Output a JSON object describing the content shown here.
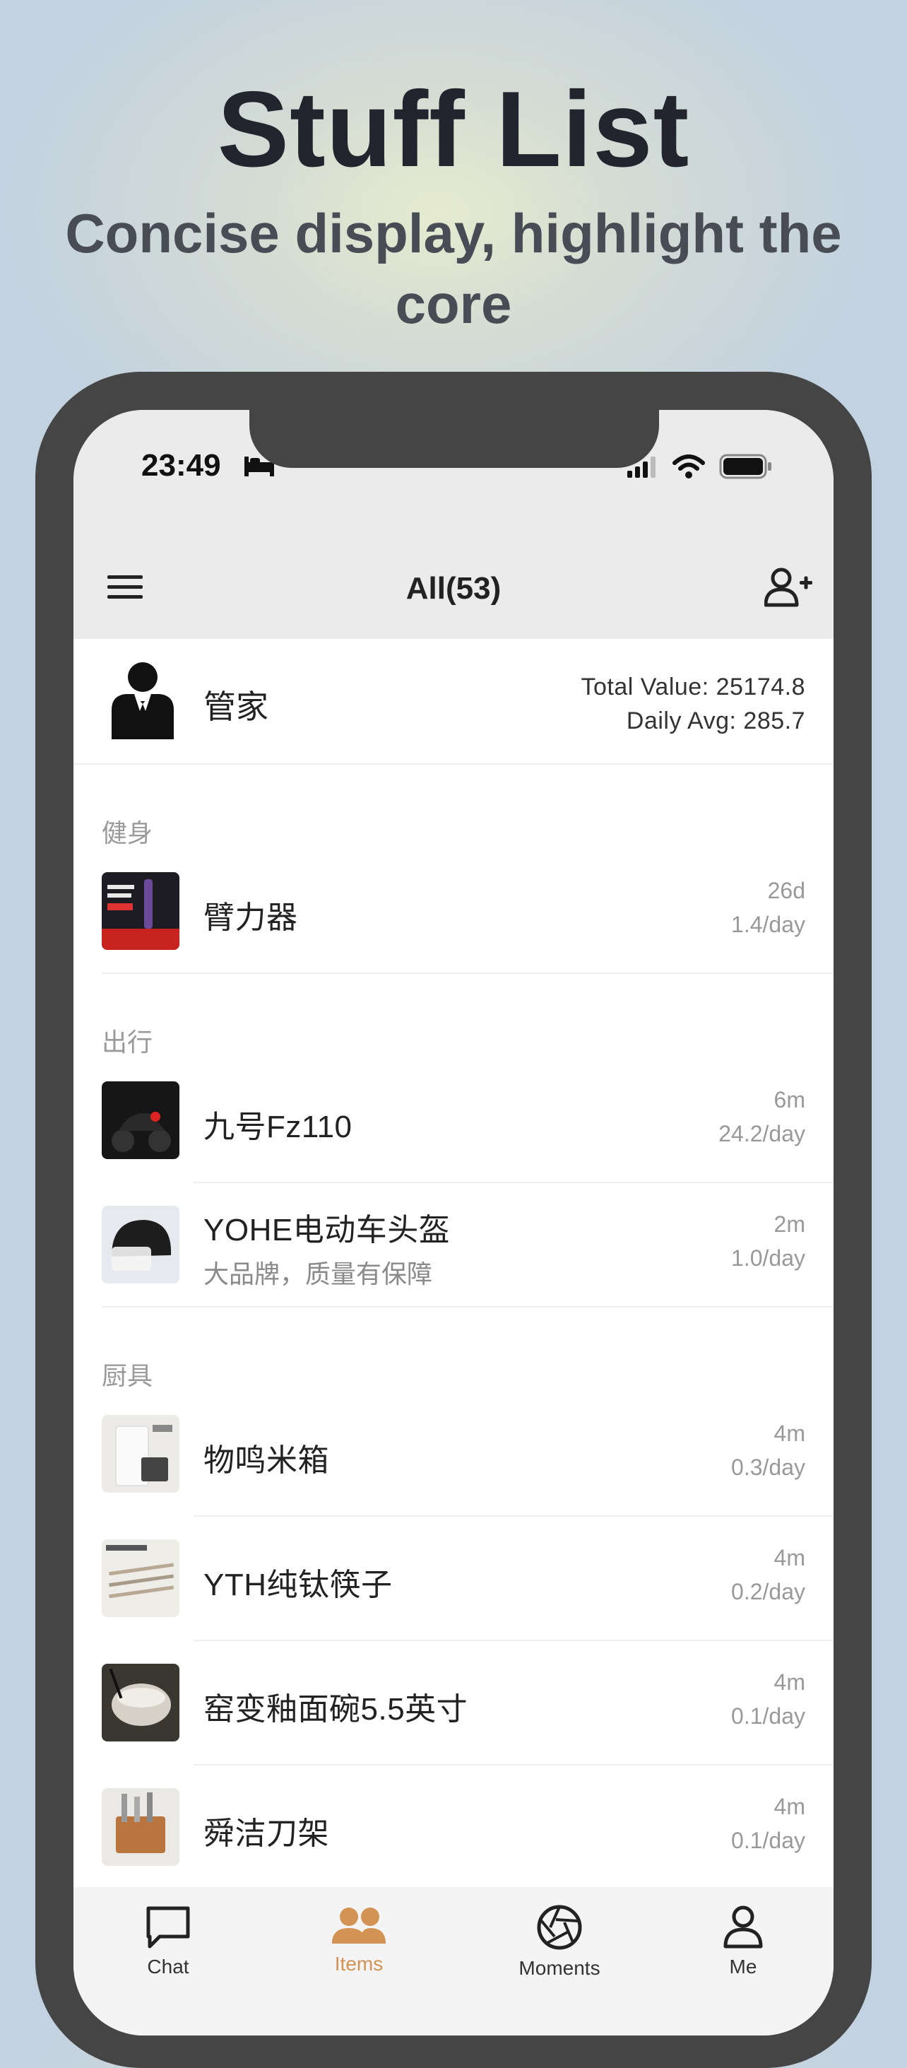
{
  "hero": {
    "title": "Stuff List",
    "subtitle": "Concise display, highlight the core"
  },
  "statusbar": {
    "time": "23:49"
  },
  "navbar": {
    "title": "All(53)"
  },
  "summary": {
    "name": "管家",
    "total_value": "Total Value: 25174.8",
    "daily_avg": "Daily Avg: 285.7"
  },
  "sections": [
    {
      "header": "健身",
      "items": [
        {
          "name": "臂力器",
          "note": "",
          "duration": "26d",
          "per_day": "1.4/day"
        }
      ]
    },
    {
      "header": "出行",
      "items": [
        {
          "name": "九号Fz110",
          "note": "",
          "duration": "6m",
          "per_day": "24.2/day"
        },
        {
          "name": "YOHE电动车头盔",
          "note": "大品牌，质量有保障",
          "duration": "2m",
          "per_day": "1.0/day"
        }
      ]
    },
    {
      "header": "厨具",
      "items": [
        {
          "name": "物鸣米箱",
          "note": "",
          "duration": "4m",
          "per_day": "0.3/day"
        },
        {
          "name": "YTH纯钛筷子",
          "note": "",
          "duration": "4m",
          "per_day": "0.2/day"
        },
        {
          "name": "窑变釉面碗5.5英寸",
          "note": "",
          "duration": "4m",
          "per_day": "0.1/day"
        },
        {
          "name": "舜洁刀架",
          "note": "",
          "duration": "4m",
          "per_day": "0.1/day"
        }
      ]
    }
  ],
  "tabs": [
    {
      "label": "Chat",
      "icon": "chat-bubble-icon"
    },
    {
      "label": "Items",
      "icon": "people-icon",
      "active": true
    },
    {
      "label": "Moments",
      "icon": "aperture-icon"
    },
    {
      "label": "Me",
      "icon": "person-icon"
    }
  ],
  "colors": {
    "accent": "#d39354",
    "navbar_bg": "#ebebeb",
    "phone_frame": "#454545"
  }
}
